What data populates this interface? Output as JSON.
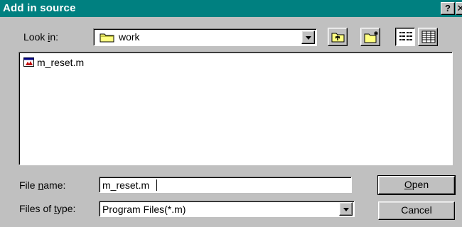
{
  "window": {
    "title": "Add in source",
    "help_label": "?",
    "close_label": "✕"
  },
  "look_in": {
    "label_prefix": "Look ",
    "label_underlined": "i",
    "label_suffix": "n:",
    "value": "work"
  },
  "toolbar": {
    "up_one_level_icon": "up-folder-icon",
    "new_folder_icon": "new-folder-icon",
    "list_view_icon": "list-view-icon",
    "details_view_icon": "details-view-icon"
  },
  "file_list": {
    "items": [
      {
        "name": "m_reset.m",
        "icon": "matlab-file-icon"
      }
    ]
  },
  "file_name": {
    "label_prefix": "File ",
    "label_underlined": "n",
    "label_suffix": "ame:",
    "value": "m_reset.m"
  },
  "file_type": {
    "label_prefix": "Files of ",
    "label_underlined": "t",
    "label_suffix": "ype:",
    "value": "Program Files(*.m)"
  },
  "buttons": {
    "open_underlined": "O",
    "open_rest": "pen",
    "cancel": "Cancel"
  },
  "colors": {
    "title_bar": "#008080",
    "face": "#c0c0c0"
  }
}
